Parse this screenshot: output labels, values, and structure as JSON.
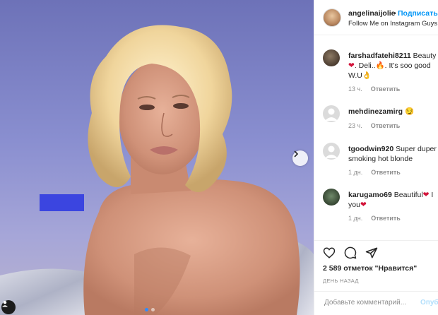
{
  "post": {
    "username": "angelinaijolie",
    "follow_label": "Подписаться",
    "subtitle": "Follow Me on Instagram Guys"
  },
  "comments": [
    {
      "username": "farshadfatehi8211",
      "text_line1": "Beauty lo",
      "text_line2": ". Deli..",
      "text_line2b": ". It's soo good",
      "text_line3": "W.U",
      "time": "13 ч.",
      "reply": "Ответить"
    },
    {
      "username": "mehdinezamirg",
      "emoji": "😏",
      "time": "23 ч.",
      "reply": "Ответить"
    },
    {
      "username": "tgoodwin920",
      "text_line1": "Super duper",
      "text_line2": "smoking hot blonde",
      "time": "1 дн.",
      "reply": "Ответить"
    },
    {
      "username": "karugamo69",
      "text_line1": "Beautiful",
      "text_line1b": "I",
      "text_line2": "you",
      "time": "1 дн.",
      "reply": "Ответить"
    }
  ],
  "actions": {
    "like_icon": "heart-outline",
    "comment_icon": "speech-bubble",
    "share_icon": "paper-plane"
  },
  "likes_text": "2 589 отметок \"Нравится\"",
  "posted_text": "ДЕНЬ НАЗАД",
  "add_comment": {
    "placeholder": "Добавьте комментарий...",
    "post_label": "Опубликовать"
  },
  "carousel": {
    "total_slides": 2,
    "current_slide": 1
  },
  "colors": {
    "accent": "#0095f6",
    "censor_box": "#3b45e0",
    "muted": "#8e8e8e"
  }
}
